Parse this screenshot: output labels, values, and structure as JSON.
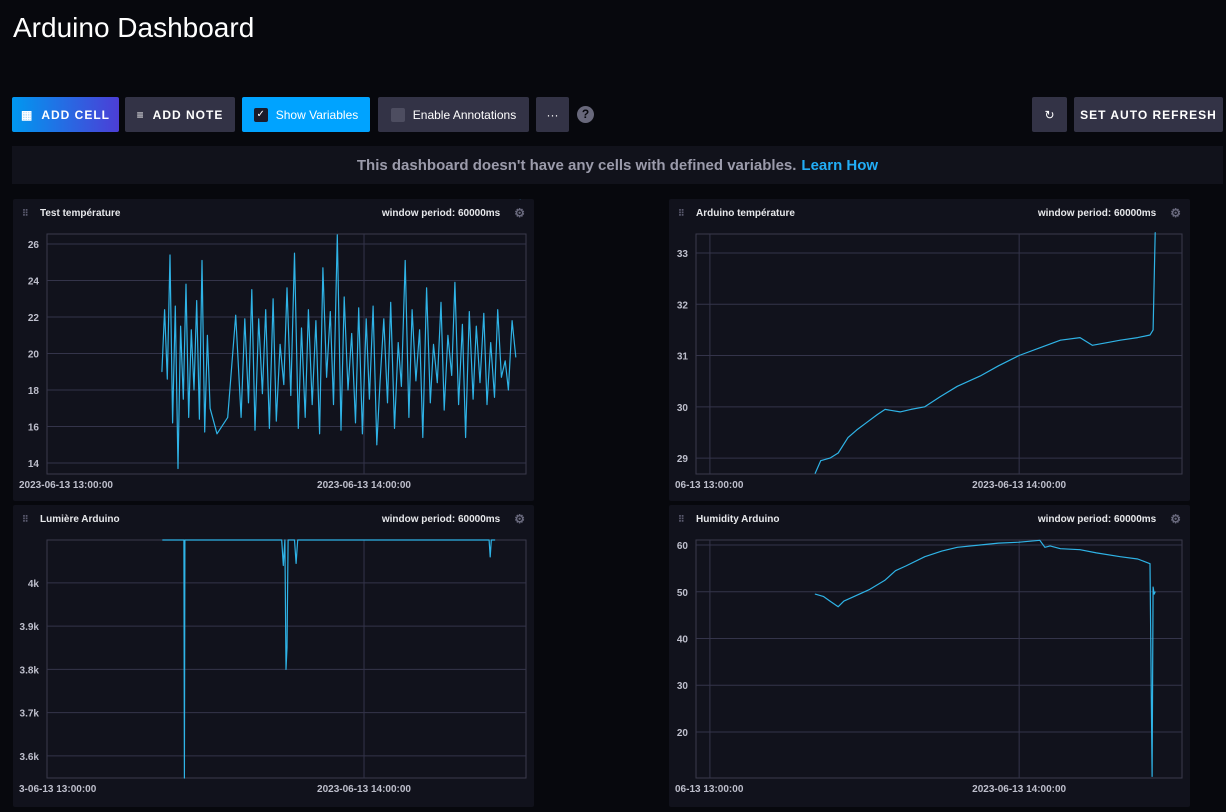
{
  "title": "Arduino Dashboard",
  "toolbar": {
    "add_cell": "ADD CELL",
    "add_note": "ADD NOTE",
    "show_variables": "Show Variables",
    "show_variables_checked": true,
    "enable_annotations": "Enable Annotations",
    "enable_annotations_checked": false,
    "more": "···",
    "help": "?",
    "auto_refresh": "SET AUTO REFRESH"
  },
  "banner": {
    "text": "This dashboard doesn't have any cells with defined variables.",
    "link": "Learn How"
  },
  "colors": {
    "line": "#2fb3e6",
    "accent": "#00a3ff"
  },
  "chart_data": [
    {
      "type": "line",
      "title": "Test température",
      "window": "window period: 60000ms",
      "xlabel": "",
      "ylabel": "",
      "x_unit": "minutes after 2023-06-13 13:00:00",
      "xlim": [
        0.7,
        90.3
      ],
      "ylim": [
        13.4,
        26.55
      ],
      "yticks": [
        14,
        16,
        18,
        20,
        22,
        24,
        26
      ],
      "ytick_labels": [
        "14",
        "16",
        "18",
        "20",
        "22",
        "24",
        "26"
      ],
      "xticks": [
        0,
        60
      ],
      "xtick_labels": [
        "2023-06-13 13:00:00",
        "2023-06-13 14:00:00"
      ],
      "x": [
        22.2,
        22.7,
        23.2,
        23.7,
        24.2,
        24.7,
        25.2,
        25.7,
        26.2,
        26.7,
        27.2,
        27.7,
        28.2,
        28.7,
        29.2,
        29.7,
        30.2,
        30.7,
        31.2,
        32.5,
        34.5,
        36,
        37,
        37.7,
        38.4,
        39,
        39.6,
        40.3,
        41,
        41.6,
        42.3,
        43,
        43.6,
        44.3,
        45,
        45.6,
        46.3,
        47,
        47.7,
        48.3,
        49,
        49.6,
        50.3,
        51,
        51.7,
        52.3,
        53,
        53.7,
        54.3,
        55,
        55.7,
        56.3,
        57,
        57.7,
        58.4,
        59,
        59.7,
        60.4,
        61,
        61.7,
        62.4,
        63,
        63.7,
        64.4,
        65,
        65.7,
        66.4,
        67,
        67.7,
        68.4,
        69,
        69.7,
        70.4,
        71,
        71.7,
        72.4,
        73,
        73.7,
        74.4,
        75,
        75.7,
        76.4,
        77,
        77.7,
        78.4,
        79,
        79.7,
        80.4,
        81,
        81.7,
        82.4,
        83,
        83.7,
        84.4,
        85,
        85.7,
        86.4,
        87,
        87.7,
        88.4,
        89.2
      ],
      "y": [
        19,
        22.4,
        18.6,
        25.4,
        16.2,
        22.6,
        13.7,
        21.5,
        17.5,
        23.8,
        16.5,
        21.3,
        18,
        22.9,
        16.4,
        25.1,
        15.7,
        21,
        17,
        15.6,
        16.5,
        22.1,
        16.5,
        21.9,
        17.3,
        23.5,
        15.8,
        21.9,
        17.8,
        22.4,
        15.9,
        23,
        16.3,
        20.5,
        18.3,
        23.6,
        17.7,
        25.5,
        15.9,
        21.4,
        16.5,
        22.4,
        17.2,
        21.8,
        15.6,
        24.7,
        18.7,
        22.3,
        17.2,
        26.5,
        15.8,
        23.1,
        18,
        21.1,
        16.2,
        22.5,
        15.6,
        21.9,
        17.5,
        22.6,
        15,
        18.5,
        21.9,
        17.3,
        22.8,
        15.9,
        20.6,
        18.2,
        25.1,
        16.5,
        22.4,
        18.5,
        21.3,
        15.4,
        23.6,
        17.3,
        20.5,
        18.4,
        22.8,
        16.9,
        21,
        18.8,
        23.9,
        17.2,
        21.6,
        15.4,
        22.3,
        17.5,
        21.5,
        18.4,
        22.2,
        17.2,
        20.6,
        17.6,
        22.4,
        18.7,
        19.6,
        18,
        21.8,
        19.8
      ]
    },
    {
      "type": "line",
      "title": "Arduino température",
      "window": "window period: 60000ms",
      "xlabel": "",
      "ylabel": "",
      "x_unit": "minutes after 2023-06-13 13:00:00",
      "xlim": [
        -2.7,
        91.6
      ],
      "ylim": [
        28.69,
        33.37
      ],
      "yticks": [
        29,
        30,
        31,
        32,
        33
      ],
      "ytick_labels": [
        "29",
        "30",
        "31",
        "32",
        "33"
      ],
      "xticks": [
        0,
        60
      ],
      "xtick_labels": [
        "06-13 13:00:00",
        "2023-06-13 14:00:00"
      ],
      "x": [
        20.4,
        21.5,
        23.3,
        24.9,
        26.8,
        28.5,
        30.5,
        32.5,
        34,
        36.9,
        39,
        41.7,
        44.7,
        48,
        52.4,
        56,
        60,
        64,
        68,
        71.8,
        74.2,
        77,
        79.6,
        83,
        85.4,
        86,
        86.4
      ],
      "y": [
        28.7,
        28.95,
        29.0,
        29.1,
        29.4,
        29.55,
        29.7,
        29.85,
        29.95,
        29.9,
        29.95,
        30.0,
        30.2,
        30.4,
        30.6,
        30.8,
        31.0,
        31.15,
        31.3,
        31.35,
        31.2,
        31.25,
        31.3,
        31.35,
        31.4,
        31.5,
        33.4
      ]
    },
    {
      "type": "line",
      "title": "Lumière Arduino",
      "window": "window period: 60000ms",
      "xlabel": "",
      "ylabel": "",
      "x_unit": "minutes after 2023-06-13 13:00:00",
      "xlim": [
        0.7,
        90.3
      ],
      "ylim": [
        3549,
        4099
      ],
      "yticks": [
        3600,
        3700,
        3800,
        3900,
        4000
      ],
      "ytick_labels": [
        "3.6k",
        "3.7k",
        "3.8k",
        "3.9k",
        "4k"
      ],
      "xticks": [
        0,
        60
      ],
      "xtick_labels": [
        "3-06-13 13:00:00",
        "2023-06-13 14:00:00"
      ],
      "x": [
        22.3,
        26.3,
        26.4,
        26.5,
        44.6,
        44.9,
        45.2,
        45.4,
        45.6,
        45.8,
        46.0,
        47.0,
        47.3,
        47.6,
        83.4,
        83.6,
        83.8,
        84.5
      ],
      "y": [
        4099,
        4099,
        3549,
        4099,
        4099,
        4040,
        4099,
        3800,
        3850,
        4099,
        4099,
        4099,
        4045,
        4099,
        4099,
        4060,
        4099,
        4099
      ]
    },
    {
      "type": "line",
      "title": "Humidity Arduino",
      "window": "window period: 60000ms",
      "xlabel": "",
      "ylabel": "",
      "x_unit": "minutes after 2023-06-13 13:00:00",
      "xlim": [
        -2.7,
        91.6
      ],
      "ylim": [
        10.16,
        61.07
      ],
      "yticks": [
        20,
        30,
        40,
        50,
        60
      ],
      "ytick_labels": [
        "20",
        "30",
        "40",
        "50",
        "60"
      ],
      "xticks": [
        0,
        60
      ],
      "xtick_labels": [
        "06-13 13:00:00",
        "2023-06-13 14:00:00"
      ],
      "x": [
        20.4,
        22,
        23.3,
        24.9,
        26,
        28,
        31,
        34,
        36,
        38,
        41.7,
        45,
        48,
        52.4,
        56,
        60,
        64,
        65,
        66,
        68,
        71.8,
        75,
        79.6,
        83,
        85.4,
        85.8,
        86,
        86.2,
        86.4
      ],
      "y": [
        49.5,
        49,
        48,
        46.8,
        48,
        49,
        50.5,
        52.5,
        54.5,
        55.5,
        57.5,
        58.7,
        59.5,
        60,
        60.4,
        60.6,
        61,
        59.5,
        59.8,
        59.2,
        59,
        58.3,
        57.5,
        57,
        56,
        10.5,
        51,
        49.5,
        50
      ]
    }
  ]
}
